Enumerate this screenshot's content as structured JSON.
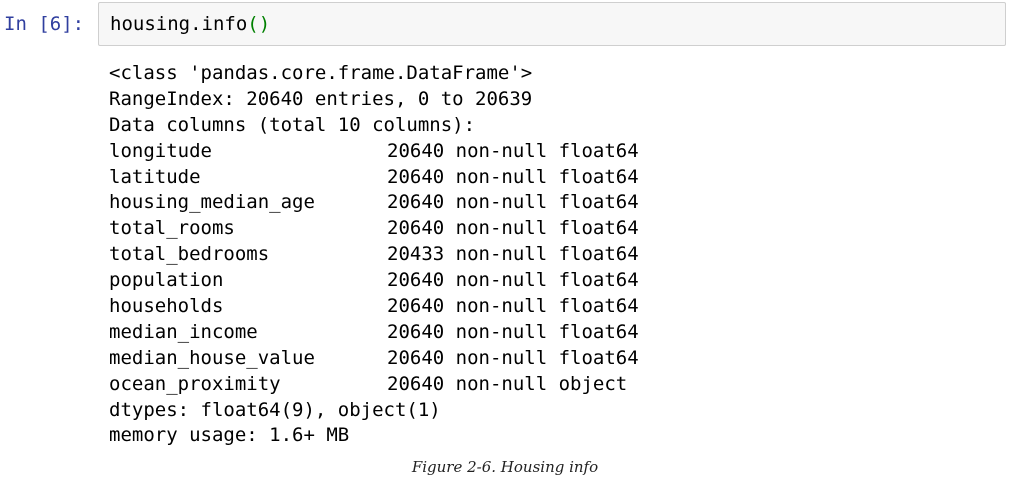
{
  "cell": {
    "prompt": "In [6]:",
    "code_text": "housing.info",
    "code_parens": "()"
  },
  "output": {
    "class_line": "<class 'pandas.core.frame.DataFrame'>",
    "range_index": "RangeIndex: 20640 entries, 0 to 20639",
    "data_columns": "Data columns (total 10 columns):",
    "columns": [
      {
        "name": "longitude",
        "info": "20640 non-null float64"
      },
      {
        "name": "latitude",
        "info": "20640 non-null float64"
      },
      {
        "name": "housing_median_age",
        "info": "20640 non-null float64"
      },
      {
        "name": "total_rooms",
        "info": "20640 non-null float64"
      },
      {
        "name": "total_bedrooms",
        "info": "20433 non-null float64"
      },
      {
        "name": "population",
        "info": "20640 non-null float64"
      },
      {
        "name": "households",
        "info": "20640 non-null float64"
      },
      {
        "name": "median_income",
        "info": "20640 non-null float64"
      },
      {
        "name": "median_house_value",
        "info": "20640 non-null float64"
      },
      {
        "name": "ocean_proximity",
        "info": "20640 non-null object"
      }
    ],
    "dtypes": "dtypes: float64(9), object(1)",
    "memory": "memory usage: 1.6+ MB"
  },
  "caption": "Figure 2-6. Housing info"
}
